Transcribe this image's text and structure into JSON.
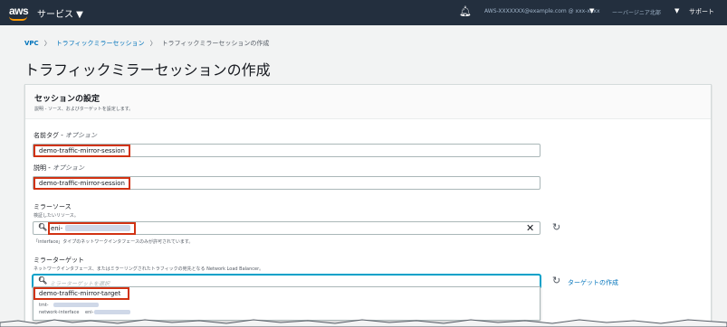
{
  "topbar": {
    "logo": "aws",
    "services": "サービス ▼",
    "bell_icon": "bell-icon",
    "account": "AWS-XXXXXXX@example.com @ xxx-xxxx",
    "region": "ーーバージニア北部",
    "support": "サポート"
  },
  "breadcrumb": {
    "root": "VPC",
    "parent": "トラフィックミラーセッション",
    "current": "トラフィックミラーセッションの作成"
  },
  "page_title": "トラフィックミラーセッションの作成",
  "panel": {
    "title": "セッションの設定",
    "description": "説明 - ソース、およびターゲットを設定します。"
  },
  "fields": {
    "name": {
      "label": "名前タグ - ",
      "optional": "オプション",
      "value": "demo-traffic-mirror-session"
    },
    "desc": {
      "label": "説明 - ",
      "optional": "オプション",
      "value": "demo-traffic-mirror-session"
    },
    "source": {
      "label": "ミラーソース",
      "hint": "検証したいリソース。",
      "value": "eni-",
      "note": "「interface」タイプのネットワークインタフェースのみが許可されています。"
    },
    "target": {
      "label": "ミラーターゲット",
      "hint": "ネットワークインタフェース、またはミラーリングされたトラフィックの宛先となる Network Load Balancer。",
      "placeholder": "ミラーターゲットを選択",
      "create_label": "ターゲットの作成"
    }
  },
  "dropdown": {
    "option_name": "demo-traffic-mirror-target",
    "option_id": "tmt-",
    "option_type": "network-interface",
    "option_eni": "eni-"
  },
  "colors": {
    "topbar_bg": "#232f3e",
    "accent": "#ff9900",
    "link": "#0073bb",
    "highlight": "#d13212",
    "focus": "#00a1c9"
  }
}
